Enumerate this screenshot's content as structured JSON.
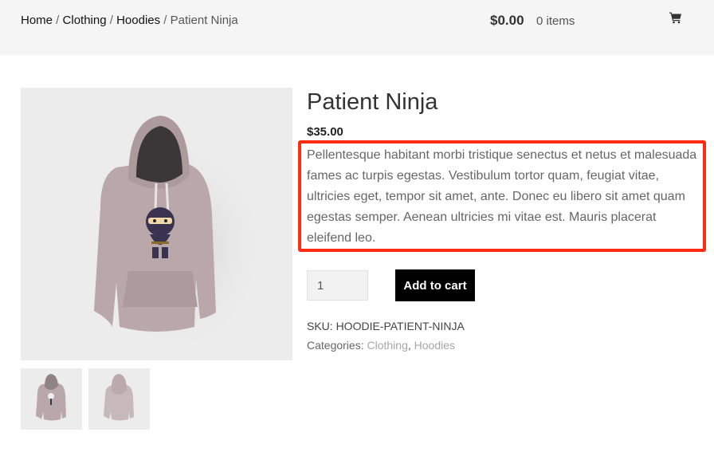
{
  "header": {
    "breadcrumb": {
      "home": "Home",
      "separator": " / ",
      "clothing": "Clothing",
      "hoodies": "Hoodies",
      "current": "Patient Ninja"
    },
    "cart": {
      "total": "$0.00",
      "count": "0 items",
      "icon": "shopping-cart-icon"
    }
  },
  "product": {
    "title": "Patient Ninja",
    "price": "$35.00",
    "description": "Pellentesque habitant morbi tristique senectus et netus et malesuada fames ac turpis egestas. Vestibulum tortor quam, feugiat vitae, ultricies eget, tempor sit amet, ante. Donec eu libero sit amet quam egestas semper. Aenean ultricies mi vitae est. Mauris placerat eleifend leo.",
    "quantity": "1",
    "add_to_cart_label": "Add to cart",
    "sku_text": "SKU: HOODIE-PATIENT-NINJA",
    "categories_label": "Categories: ",
    "categories": [
      "Clothing",
      "Hoodies"
    ],
    "categories_separator": ", "
  },
  "colors": {
    "highlight": "#ff2a12",
    "button": "#000000",
    "hoodie": "#b9a7a9"
  }
}
